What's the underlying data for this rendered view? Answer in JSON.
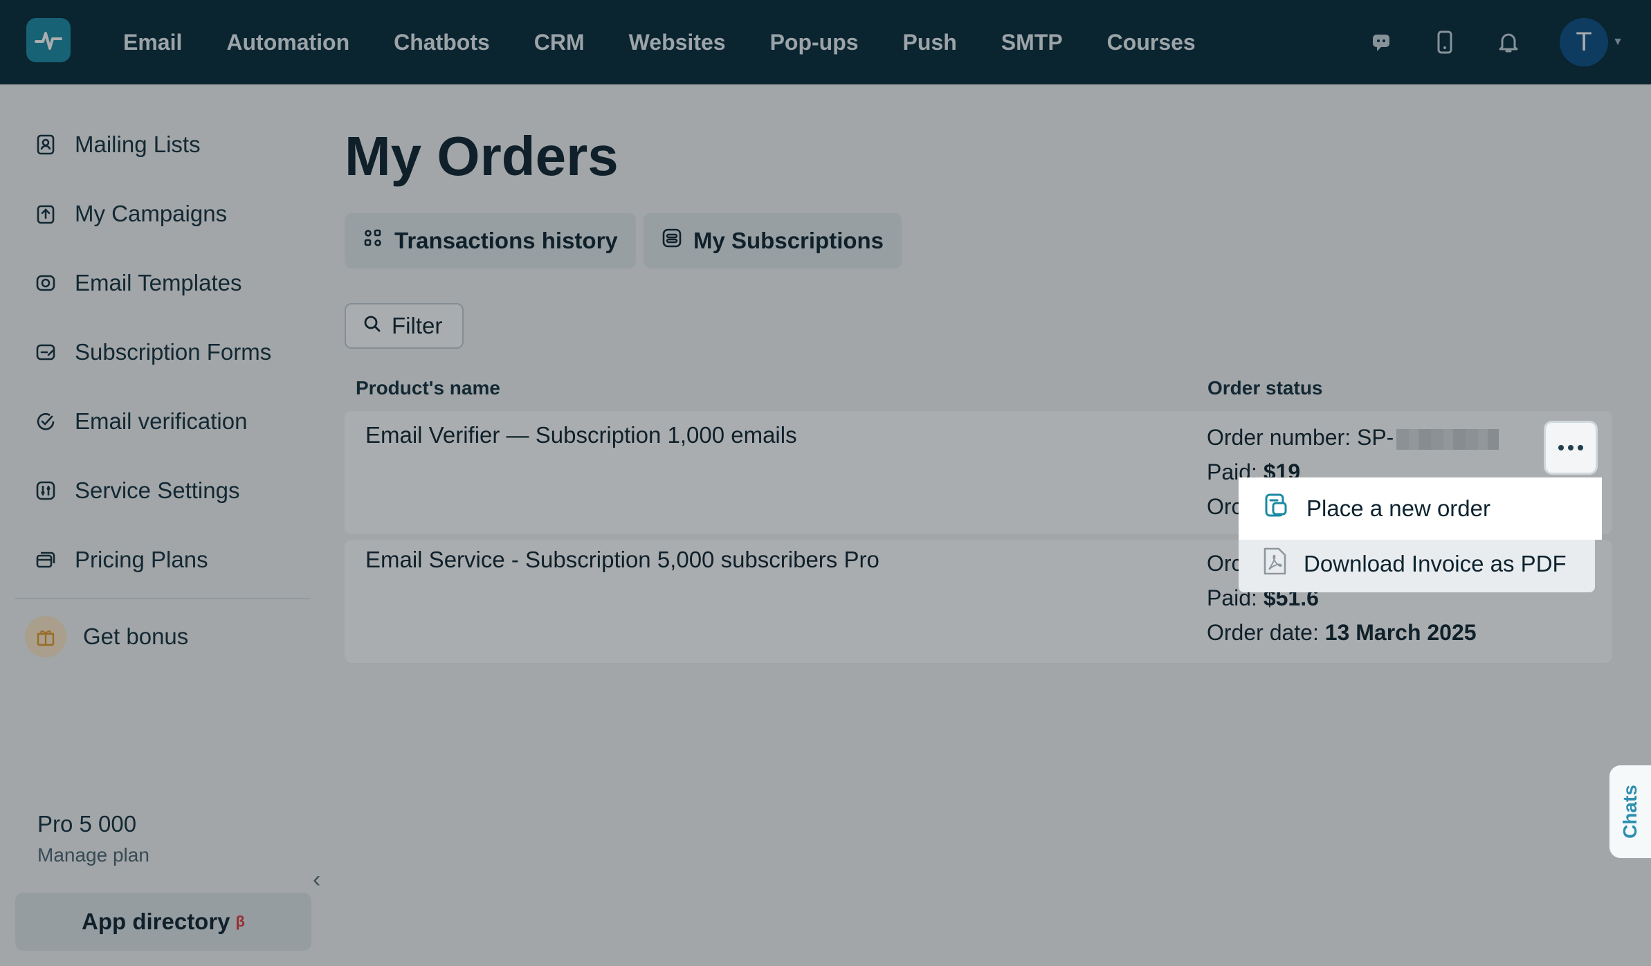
{
  "nav": {
    "items": [
      "Email",
      "Automation",
      "Chatbots",
      "CRM",
      "Websites",
      "Pop-ups",
      "Push",
      "SMTP",
      "Courses"
    ],
    "avatar_letter": "T"
  },
  "sidebar": {
    "items": [
      {
        "label": "Mailing Lists",
        "icon": "contacts-icon"
      },
      {
        "label": "My Campaigns",
        "icon": "campaign-upload-icon"
      },
      {
        "label": "Email Templates",
        "icon": "templates-icon"
      },
      {
        "label": "Subscription Forms",
        "icon": "forms-icon"
      },
      {
        "label": "Email verification",
        "icon": "check-circle-icon"
      },
      {
        "label": "Service Settings",
        "icon": "settings-sliders-icon"
      },
      {
        "label": "Pricing Plans",
        "icon": "pricing-cards-icon"
      }
    ],
    "bonus_label": "Get bonus",
    "plan_name": "Pro 5 000",
    "manage_plan": "Manage plan",
    "app_directory": "App directory",
    "beta_mark": "β"
  },
  "main": {
    "title": "My Orders",
    "tabs": [
      {
        "label": "Transactions history",
        "icon": "transactions-icon"
      },
      {
        "label": "My Subscriptions",
        "icon": "subscriptions-icon"
      }
    ],
    "filter_label": "Filter",
    "columns": {
      "product": "Product's name",
      "status": "Order status"
    },
    "orders": [
      {
        "product": "Email Verifier — Subscription 1,000 emails",
        "order_number_label": "Order number: SP-",
        "paid_label": "Paid: ",
        "paid_value": "$19",
        "date_label_partial": "Orc"
      },
      {
        "product": "Email Service - Subscription 5,000 subscribers Pro",
        "order_label_partial": "Orc",
        "paid_label": "Paid: ",
        "paid_value": "$51.6",
        "date_label": "Order date: ",
        "date_value": "13 March 2025"
      }
    ]
  },
  "menu": {
    "items": [
      {
        "label": "Place a new order",
        "icon": "new-order-icon"
      },
      {
        "label": "Download Invoice as PDF",
        "icon": "pdf-icon"
      }
    ]
  },
  "chats_label": "Chats",
  "colors": {
    "topbar": "#062a39",
    "accent": "#1a8aa3",
    "avatar": "#0b4f86"
  }
}
